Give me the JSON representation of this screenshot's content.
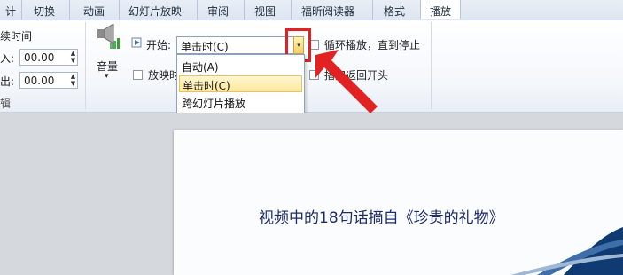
{
  "tabs": [
    "计",
    "切换",
    "动画",
    "幻灯片放映",
    "审阅",
    "视图",
    "福昕阅读器",
    "格式",
    "播放"
  ],
  "selected_tab": "播放",
  "ribbon": {
    "group1": {
      "title": "续时间",
      "fade_in_label": "入:",
      "fade_in_value": "00.00",
      "fade_out_label": "出:",
      "fade_out_value": "00.00",
      "footer": "辑"
    },
    "volume": {
      "label": "音量",
      "arrow": "▾"
    },
    "start": {
      "label": "开始:",
      "value": "单击时(C)",
      "dropdown_arrow": "▾",
      "options": [
        "自动(A)",
        "单击时(C)",
        "跨幻灯片播放"
      ],
      "selected_option": "单击时(C)"
    },
    "loop_label": "循环播放，直到停止",
    "hide_label_partial": "放映时",
    "rewind_label_partial": "播完返回开头"
  },
  "slide": {
    "title": "视频中的18句话摘自《珍贵的礼物》"
  },
  "colors": {
    "highlight": "#e02222",
    "arrow": "#e02222",
    "slide_title": "#1d2a6b"
  }
}
